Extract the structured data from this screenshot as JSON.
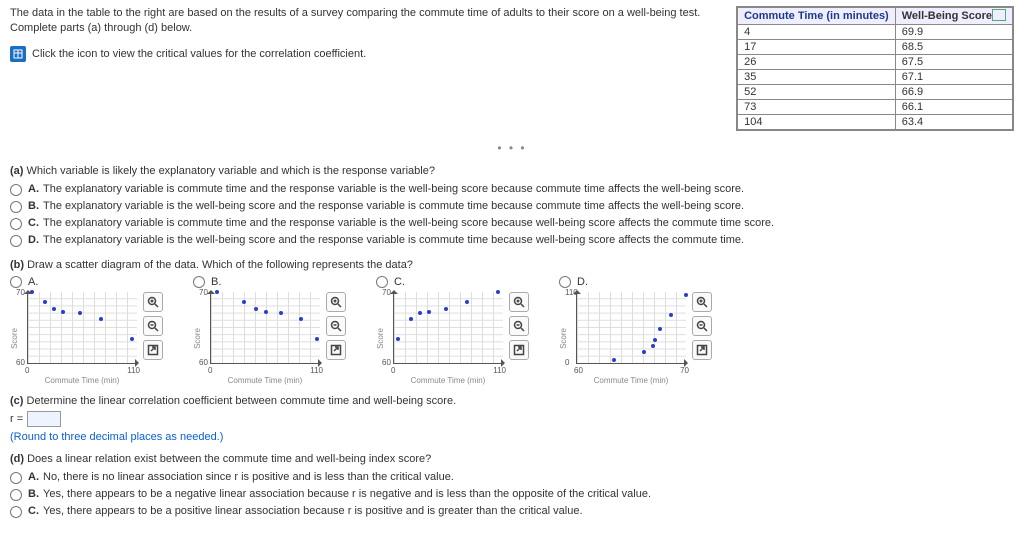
{
  "intro": "The data in the table to the right are based on the results of a survey comparing the commute time of adults to their score on a well-being test. Complete parts (a) through (d) below.",
  "crit_link": "Click the icon to view the critical values for the correlation coefficient.",
  "table": {
    "h1": "Commute Time (in minutes)",
    "h2": "Well-Being Score",
    "rows": [
      {
        "c": "4",
        "w": "69.9"
      },
      {
        "c": "17",
        "w": "68.5"
      },
      {
        "c": "26",
        "w": "67.5"
      },
      {
        "c": "35",
        "w": "67.1"
      },
      {
        "c": "52",
        "w": "66.9"
      },
      {
        "c": "73",
        "w": "66.1"
      },
      {
        "c": "104",
        "w": "63.4"
      }
    ]
  },
  "more": "• • •",
  "qa": {
    "label": "(a)",
    "text": "Which variable is likely the explanatory variable and which is the response variable?"
  },
  "a_opts": {
    "A": "The explanatory variable is commute time and the response variable is the well-being score because commute time affects the well-being score.",
    "B": "The explanatory variable is the well-being score and the response variable is commute time because commute time affects the well-being score.",
    "C": "The explanatory variable is commute time and the response variable is the well-being score because well-being score affects the commute time score.",
    "D": "The explanatory variable is the well-being score and the response variable is commute time because well-being score affects the commute time."
  },
  "qb": {
    "label": "(b)",
    "text": "Draw a scatter diagram of the data. Which of the following represents the data?"
  },
  "axis": {
    "y": "Score",
    "x": "Commute Time (min)"
  },
  "chart_labels": {
    "A": "A.",
    "B": "B.",
    "C": "C.",
    "D": "D."
  },
  "chart_ticks": {
    "A": {
      "x0": "0",
      "x1": "110",
      "y0": "60",
      "y1": "70"
    },
    "B": {
      "x0": "0",
      "x1": "110",
      "y0": "60",
      "y1": "70"
    },
    "C": {
      "x0": "0",
      "x1": "110",
      "y0": "60",
      "y1": "70"
    },
    "D": {
      "x0": "60",
      "x1": "70",
      "y0": "0",
      "y1": "110"
    }
  },
  "chart_data": [
    {
      "type": "scatter",
      "id": "A",
      "xlim": [
        0,
        110
      ],
      "ylim": [
        60,
        70
      ],
      "xlabel": "Commute Time (min)",
      "ylabel": "Score",
      "points": [
        [
          4,
          69.9
        ],
        [
          17,
          68.5
        ],
        [
          26,
          67.5
        ],
        [
          35,
          67.1
        ],
        [
          52,
          66.9
        ],
        [
          73,
          66.1
        ],
        [
          104,
          63.4
        ]
      ]
    },
    {
      "type": "scatter",
      "id": "B",
      "xlim": [
        0,
        110
      ],
      "ylim": [
        60,
        70
      ],
      "xlabel": "Commute Time (min)",
      "ylabel": "Score",
      "points": [
        [
          6,
          69.9
        ],
        [
          33,
          68.5
        ],
        [
          45,
          67.5
        ],
        [
          55,
          67.1
        ],
        [
          70,
          66.9
        ],
        [
          90,
          66.1
        ],
        [
          106,
          63.4
        ]
      ]
    },
    {
      "type": "scatter",
      "id": "C",
      "xlim": [
        0,
        110
      ],
      "ylim": [
        60,
        70
      ],
      "xlabel": "Commute Time (min)",
      "ylabel": "Score",
      "points": [
        [
          4,
          63.4
        ],
        [
          17,
          66.1
        ],
        [
          26,
          66.9
        ],
        [
          35,
          67.1
        ],
        [
          52,
          67.5
        ],
        [
          73,
          68.5
        ],
        [
          104,
          69.9
        ]
      ]
    },
    {
      "type": "scatter",
      "id": "D",
      "xlim": [
        60,
        70
      ],
      "ylim": [
        0,
        110
      ],
      "xlabel": "Commute Time (min)",
      "ylabel": "Score",
      "points": [
        [
          63.4,
          4
        ],
        [
          66.1,
          17
        ],
        [
          66.9,
          26
        ],
        [
          67.1,
          35
        ],
        [
          67.5,
          52
        ],
        [
          68.5,
          73
        ],
        [
          69.9,
          104
        ]
      ]
    }
  ],
  "qc": {
    "label": "(c)",
    "text": "Determine the linear correlation coefficient between commute time and well-being score."
  },
  "r_label": "r =",
  "r_note": "(Round to three decimal places as needed.)",
  "qd": {
    "label": "(d)",
    "text": "Does a linear relation exist between the commute time and well-being index score?"
  },
  "d_opts": {
    "A": "No, there is no linear association since r is positive and is less than the critical value.",
    "B": "Yes, there appears to be a negative linear association because r is negative and is less than the opposite of the critical value.",
    "C": "Yes, there appears to be a positive linear association because r is positive and is greater than the critical value."
  }
}
